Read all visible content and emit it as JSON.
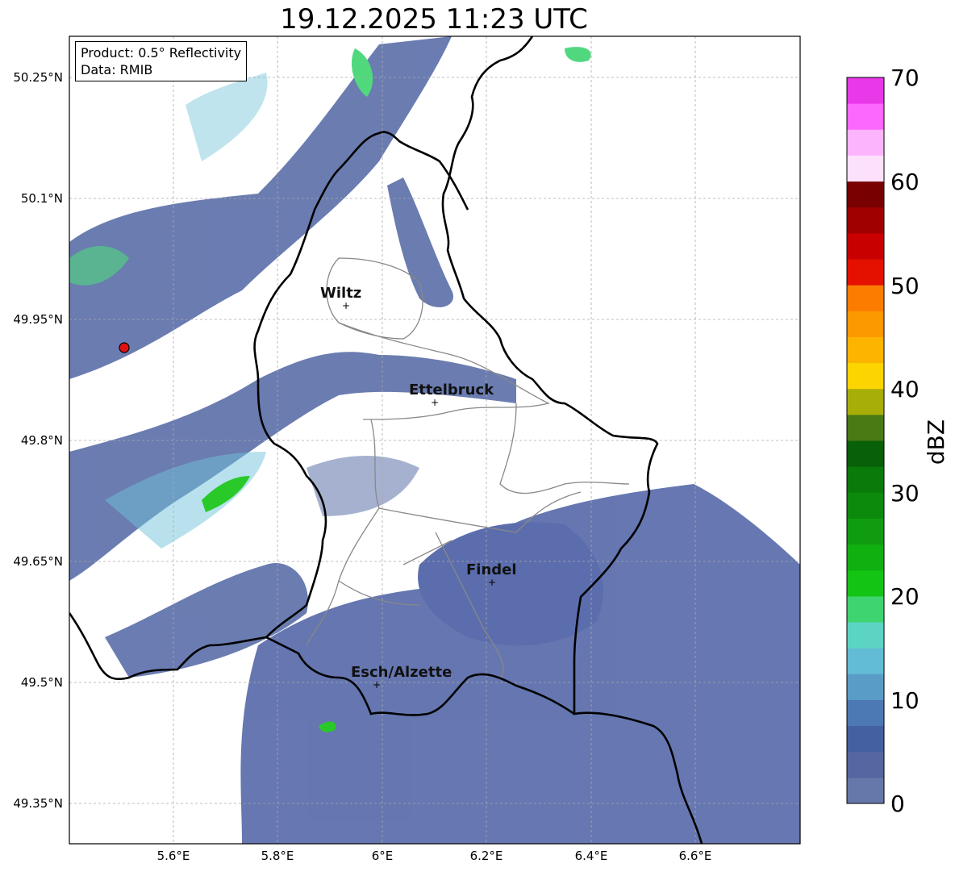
{
  "title": "19.12.2025 11:23 UTC",
  "info": {
    "product": "Product: 0.5° Reflectivity",
    "data": "Data: RMIB"
  },
  "map": {
    "lon_ticks": [
      "5.6°E",
      "5.8°E",
      "6°E",
      "6.2°E",
      "6.4°E",
      "6.6°E"
    ],
    "lat_ticks": [
      "50.25°N",
      "50.1°N",
      "49.95°N",
      "49.8°N",
      "49.65°N",
      "49.5°N",
      "49.35°N"
    ],
    "cities": [
      {
        "name": "Wiltz"
      },
      {
        "name": "Ettelbruck"
      },
      {
        "name": "Findel"
      },
      {
        "name": "Esch/Alzette"
      }
    ],
    "radar_marker_color": "#e01010",
    "border_color": "#000000",
    "canton_color": "#888888"
  },
  "colorbar": {
    "label": "dBZ",
    "ticks": [
      "0",
      "10",
      "20",
      "30",
      "40",
      "50",
      "60",
      "70"
    ],
    "colors": [
      "#6677aa",
      "#5566a0",
      "#4460a0",
      "#4c78b4",
      "#5a9cc8",
      "#62bcd6",
      "#5cd4c4",
      "#3ed470",
      "#14c414",
      "#10b010",
      "#109c10",
      "#0c8a0c",
      "#0a7a0a",
      "#086008",
      "#4a7a14",
      "#a8ae08",
      "#fcd400",
      "#fcb400",
      "#fc9800",
      "#fc7c00",
      "#e41000",
      "#c80000",
      "#a00000",
      "#780000",
      "#fce0fc",
      "#fcb4fc",
      "#fc68fc",
      "#e838e8"
    ]
  }
}
